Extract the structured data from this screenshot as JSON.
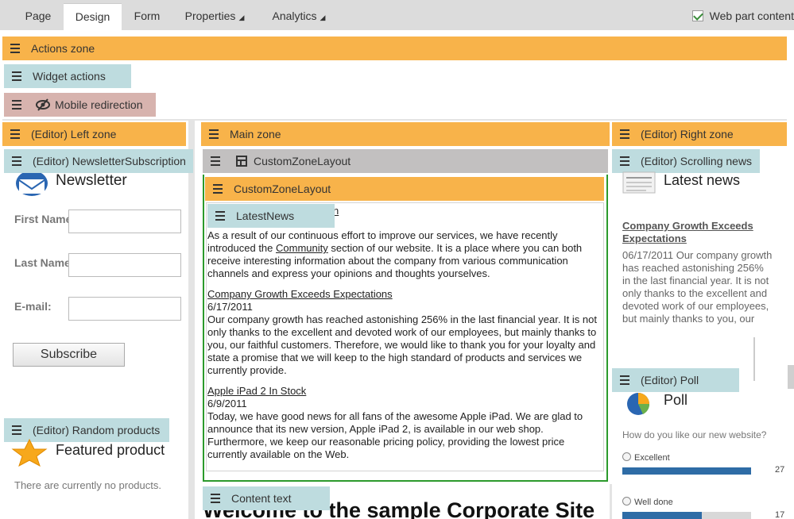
{
  "tabs": [
    {
      "label": "Page"
    },
    {
      "label": "Design"
    },
    {
      "label": "Form"
    },
    {
      "label": "Properties"
    },
    {
      "label": "Analytics"
    }
  ],
  "web_part_content_label": "Web part content",
  "zones": {
    "actions": "Actions zone",
    "widget_actions": "Widget actions",
    "mobile_redirection": "Mobile redirection",
    "left": "(Editor) Left zone",
    "main": "Main zone",
    "right": "(Editor) Right zone"
  },
  "left": {
    "newsletter_handle": "(Editor) NewsletterSubscription",
    "newsletter_title": "Newsletter",
    "first_name_label": "First Name",
    "last_name_label": "Last Name",
    "email_label": "E-mail:",
    "subscribe_label": "Subscribe",
    "random_handle": "(Editor) Random products",
    "featured_title": "Featured product",
    "no_products": "There are currently no products."
  },
  "main": {
    "layout1": "CustomZoneLayout",
    "layout2": "CustomZoneLayout",
    "latest_news_handle": "LatestNews",
    "partial_link": "n",
    "intro_before": "As a result of our continuous effort to improve our services, we have recently introduced the ",
    "intro_link": "Community",
    "intro_after": " section of our website. It is a place where you can both receive interesting information about the company from various communication channels and express your opinions and thoughts yourselves.",
    "news": [
      {
        "title": "Company Growth Exceeds Expectations",
        "date": "6/17/2011",
        "text": "Our company growth has reached astonishing 256% in the last financial year. It is not only thanks to the excellent and devoted work of our employees, but mainly thanks to you, our faithful customers. Therefore, we would like to thank you for your loyalty and state a promise that we will keep to the high standard of products and services we currently provide."
      },
      {
        "title": "Apple iPad 2 In Stock",
        "date": "6/9/2011",
        "text": "Today, we have good news for all fans of the awesome Apple iPad. We are glad to announce that its new version, Apple iPad 2, is available in our web shop. Furthermore, we keep our reasonable pricing policy, providing the lowest price currently available on the Web."
      }
    ],
    "content_text_handle": "Content text",
    "welcome": "Welcome to the sample Corporate Site"
  },
  "right": {
    "scrolling_handle": "(Editor) Scrolling news",
    "latest_news_title": "Latest news",
    "news_link": "Company Growth Exceeds Expectations",
    "news_text": "06/17/2011 Our company growth has reached astonishing 256% in the last financial year. It is not only thanks to the excellent and devoted work of our employees, but mainly thanks to you, our faithful customers.",
    "poll_handle": "(Editor) Poll",
    "poll_title": "Poll",
    "poll_question": "How do you like our new website?",
    "poll_options": [
      {
        "label": "Excellent",
        "count": "27",
        "fraction": 1.0
      },
      {
        "label": "Well done",
        "count": "17",
        "fraction": 0.62
      }
    ]
  },
  "colors": {
    "zone_orange": "#f8b34a",
    "widget_teal": "#bedcdf",
    "mobile_rose": "#d7b3ae",
    "layout_gray": "#c2c0c0",
    "main_border_green": "#2c9a2c",
    "poll_bar_blue": "#2e6ca6"
  },
  "icons": [
    "menu-icon",
    "eye-slash-icon",
    "layout-icon",
    "envelope-icon",
    "star-icon",
    "newspaper-icon",
    "pie-chart-icon",
    "checkbox-icon",
    "radio-icon",
    "dropdown-triangle-icon"
  ]
}
